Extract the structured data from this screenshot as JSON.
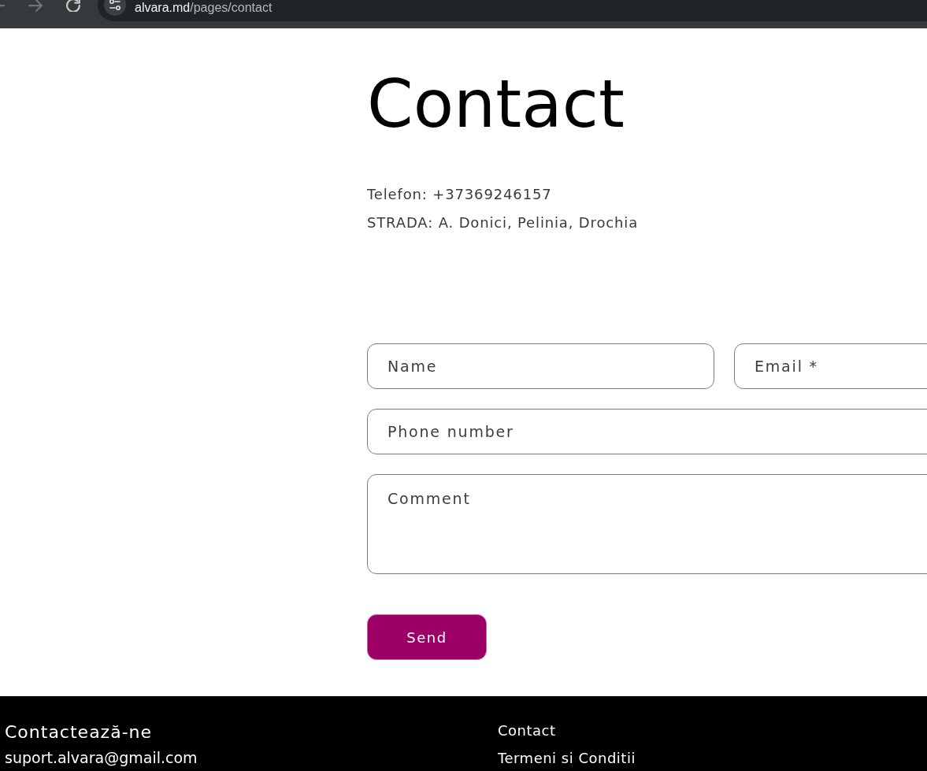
{
  "browser": {
    "nav_buttons": [
      {
        "kind": "back",
        "disabled": true
      },
      {
        "kind": "forward",
        "disabled": true
      },
      {
        "kind": "reload",
        "disabled": false
      }
    ],
    "url_host": "alvara.md",
    "url_path": "/pages/contact"
  },
  "page": {
    "title": "Contact",
    "info_lines": [
      "Telefon: +37369246157",
      "STRADA: A. Donici, Pelinia, Drochia"
    ]
  },
  "form": {
    "rows": [
      {
        "fields": [
          {
            "kind": "input",
            "placeholder": "Name"
          },
          {
            "kind": "input",
            "placeholder": "Email *"
          }
        ]
      },
      {
        "fields": [
          {
            "kind": "input",
            "placeholder": "Phone number"
          }
        ]
      },
      {
        "fields": [
          {
            "kind": "textarea",
            "placeholder": "Comment"
          }
        ]
      }
    ],
    "submit": "Send"
  },
  "footer": {
    "heading": "Contactează-ne",
    "email": "suport.alvara@gmail.com",
    "links": [
      "Contact",
      "Termeni si Conditii"
    ]
  }
}
